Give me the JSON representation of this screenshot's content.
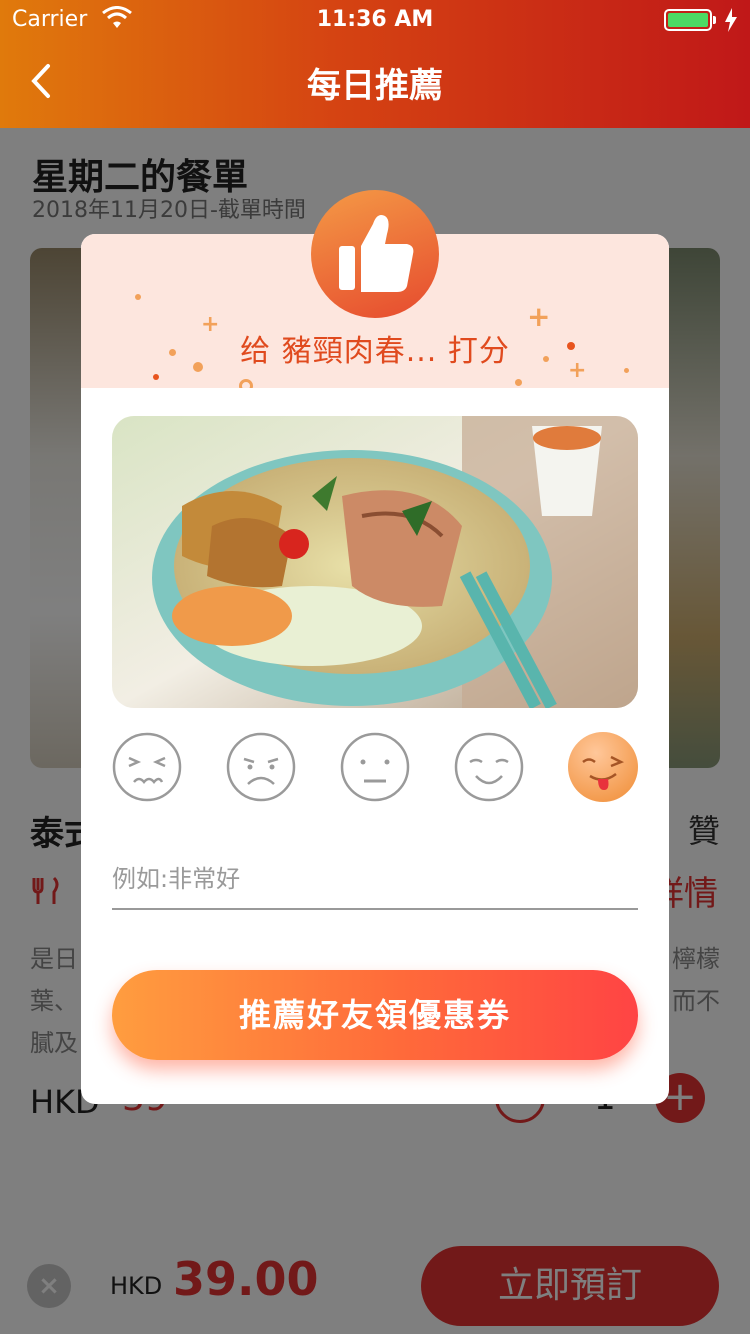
{
  "status_bar": {
    "carrier": "Carrier",
    "time": "11:36 AM"
  },
  "nav": {
    "title": "每日推薦"
  },
  "page": {
    "menu_title": "星期二的餐單",
    "menu_subtitle": "2018年11月20日-截單時間",
    "dish_name": "泰式",
    "like_label": "贊",
    "detail_label": "詳情",
    "desc_left": "是日葉、膩及",
    "desc_right": "檸檬而不",
    "price_unit": "HKD",
    "price_value": "39",
    "quantity": "1",
    "plus": "+"
  },
  "bottom_bar": {
    "close": "×",
    "unit": "HKD",
    "total": "39.00",
    "order_label": "立即預訂"
  },
  "modal": {
    "rate_title": "给 豬頸肉春... 打分",
    "faces": [
      "very-bad-face-icon",
      "bad-face-icon",
      "neutral-face-icon",
      "good-face-icon",
      "delicious-face-icon"
    ],
    "selected_face": 5,
    "comment_placeholder": "例如:非常好",
    "recommend_label": "推薦好友領優惠券"
  },
  "colors": {
    "accent": "#e53232",
    "header_start": "#e07a0c",
    "header_end": "#c01818",
    "modal_head": "#fde6de",
    "button_start": "#ff9d3f",
    "button_end": "#ff4444"
  }
}
